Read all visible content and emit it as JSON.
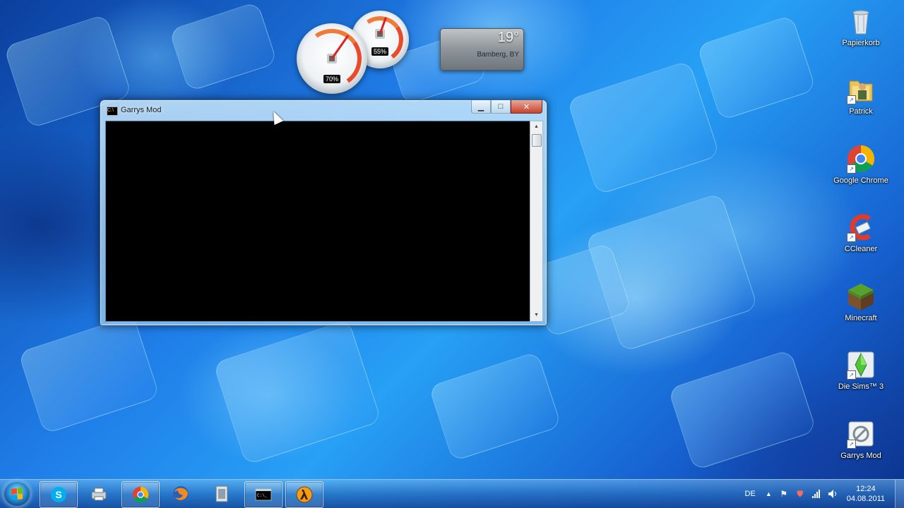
{
  "gadgets": {
    "cpu_meter": {
      "cpu_percent": "70%",
      "memory_percent": "55%"
    },
    "weather": {
      "temperature": "19°",
      "location": "Bamberg, BY"
    }
  },
  "desktop_icons": [
    {
      "label": "Papierkorb",
      "icon": "recycle-bin-icon"
    },
    {
      "label": "Patrick",
      "icon": "user-folder-icon"
    },
    {
      "label": "Google Chrome",
      "icon": "chrome-icon"
    },
    {
      "label": "CCleaner",
      "icon": "ccleaner-icon"
    },
    {
      "label": "Minecraft",
      "icon": "minecraft-icon"
    },
    {
      "label": "Die Sims™ 3",
      "icon": "sims3-icon"
    },
    {
      "label": "Garrys Mod",
      "icon": "garrys-mod-icon"
    }
  ],
  "console_window": {
    "title": "Garrys Mod",
    "minimize_symbol": "▁",
    "maximize_symbol": "□",
    "close_symbol": "✕",
    "scroll_up": "▲",
    "scroll_down": "▼"
  },
  "taskbar": {
    "items": [
      "skype-icon",
      "printer-icon",
      "chrome-icon",
      "firefox-icon",
      "film-icon",
      "console-icon",
      "half-life-icon"
    ],
    "tray": {
      "language": "DE",
      "show_hidden": "▲",
      "time": "12:24",
      "date": "04.08.2011"
    }
  },
  "colors": {
    "close_button": "#c5442d",
    "console_bg": "#000000",
    "accent": "#1f7de8"
  }
}
